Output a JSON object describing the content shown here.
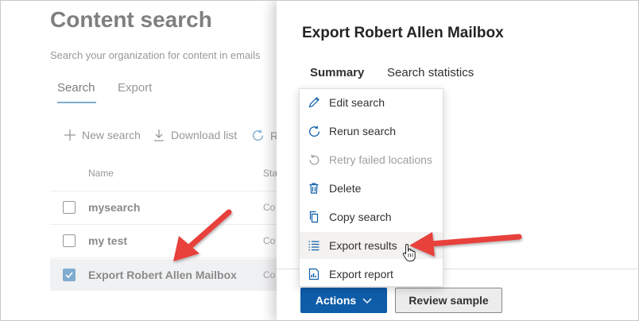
{
  "background": {
    "title": "Content search",
    "subtitle": "Search your organization for content in emails",
    "tabs": [
      {
        "label": "Search",
        "active": true
      },
      {
        "label": "Export",
        "active": false
      }
    ],
    "toolbar": {
      "new_search": "New search",
      "download_list": "Download list",
      "refresh_truncated": "R"
    },
    "columns": {
      "name": "Name",
      "status_truncated": "Sta"
    },
    "rows": [
      {
        "name": "mysearch",
        "status": "Co",
        "checked": false
      },
      {
        "name": "my test",
        "status": "Co",
        "checked": false
      },
      {
        "name": "Export Robert Allen Mailbox",
        "status": "Co",
        "checked": true
      }
    ]
  },
  "panel": {
    "title": "Export Robert Allen Mailbox",
    "tabs": [
      {
        "label": "Summary",
        "active": true
      },
      {
        "label": "Search statistics",
        "active": false
      }
    ],
    "actions_label": "Actions",
    "review_sample_label": "Review sample"
  },
  "menu": {
    "items": [
      {
        "label": "Edit search",
        "icon": "pencil-icon",
        "disabled": false
      },
      {
        "label": "Rerun search",
        "icon": "refresh-icon",
        "disabled": false
      },
      {
        "label": "Retry failed locations",
        "icon": "retry-icon",
        "disabled": true
      },
      {
        "label": "Delete",
        "icon": "trash-icon",
        "disabled": false
      },
      {
        "label": "Copy search",
        "icon": "copy-icon",
        "disabled": false
      },
      {
        "label": "Export results",
        "icon": "list-icon",
        "disabled": false,
        "hovered": true
      },
      {
        "label": "Export report",
        "icon": "report-icon",
        "disabled": false
      }
    ]
  },
  "colors": {
    "primary": "#0f5da9",
    "annotation_arrow": "#e8403a",
    "checkbox_accent": "#6fa1c9"
  }
}
